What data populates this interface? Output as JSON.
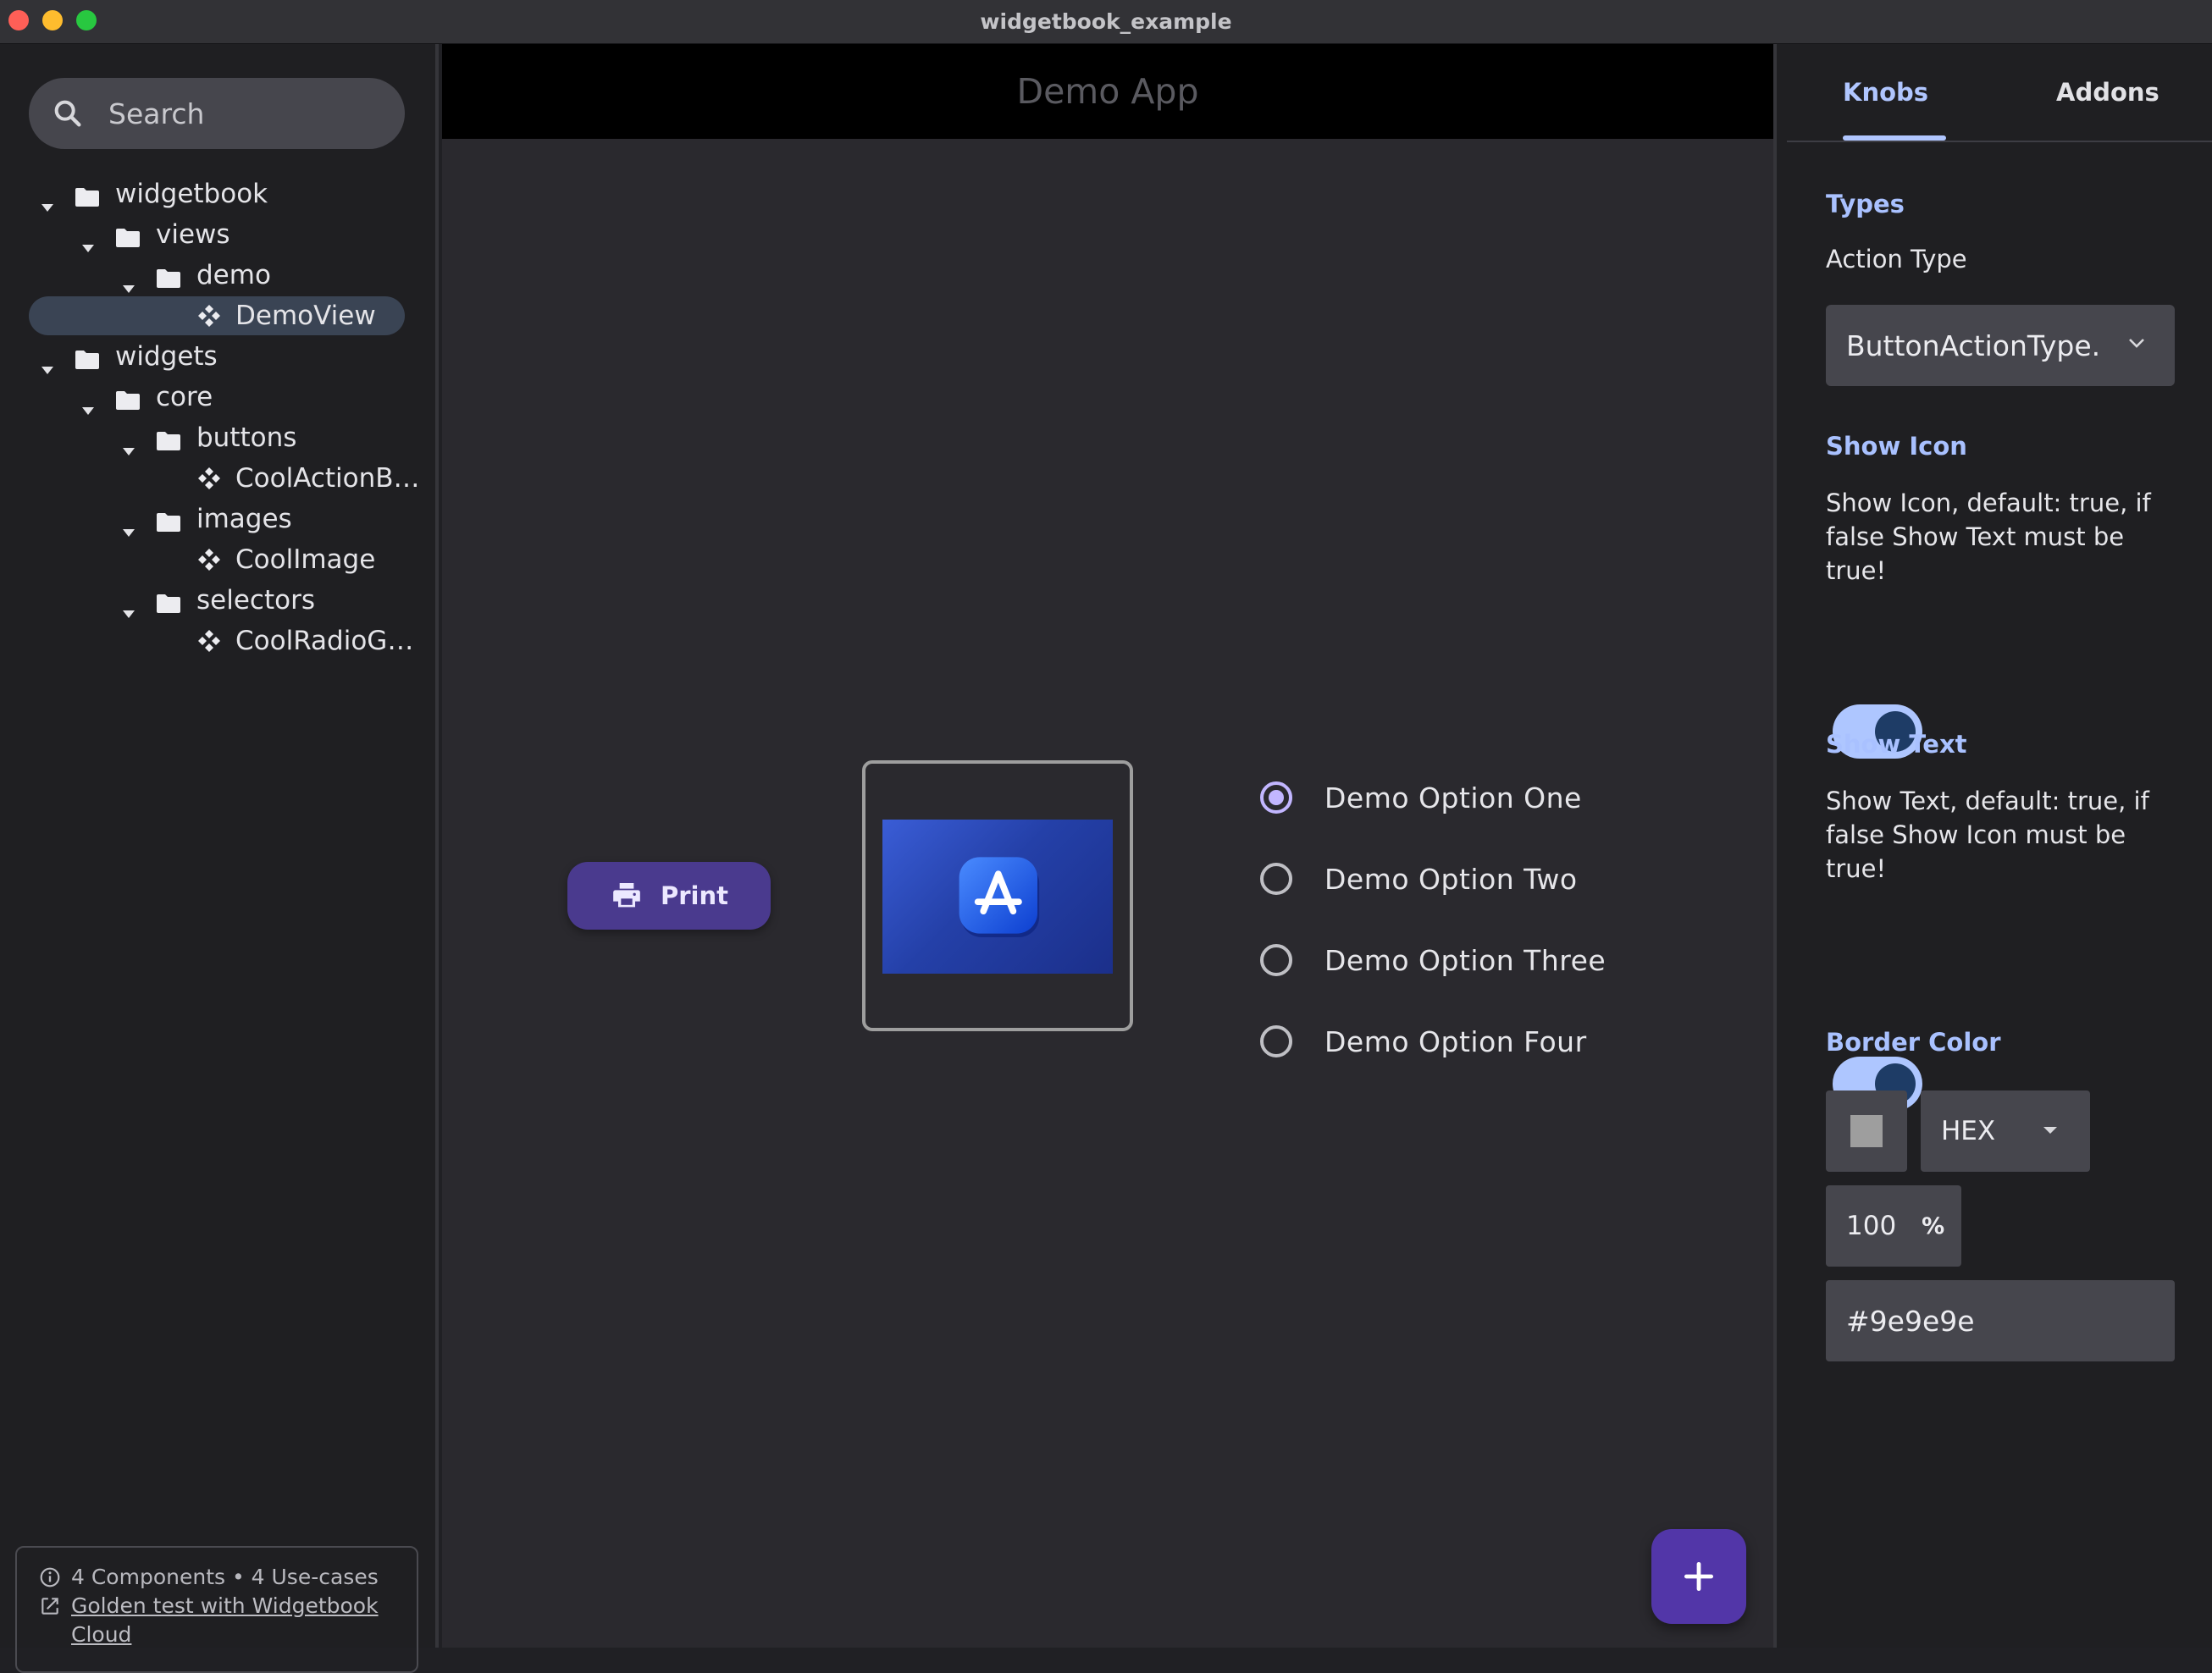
{
  "window": {
    "title": "widgetbook_example"
  },
  "navigation": {
    "search_placeholder": "Search",
    "tree": [
      {
        "label": "widgetbook",
        "kind": "folder",
        "depth": 0,
        "expanded": true
      },
      {
        "label": "views",
        "kind": "folder",
        "depth": 1,
        "expanded": true
      },
      {
        "label": "demo",
        "kind": "folder",
        "depth": 2,
        "expanded": true
      },
      {
        "label": "DemoView",
        "kind": "component",
        "depth": 3,
        "selected": true
      },
      {
        "label": "widgets",
        "kind": "folder",
        "depth": 0,
        "expanded": true
      },
      {
        "label": "core",
        "kind": "folder",
        "depth": 1,
        "expanded": true
      },
      {
        "label": "buttons",
        "kind": "folder",
        "depth": 2,
        "expanded": true
      },
      {
        "label": "CoolActionB…",
        "kind": "component",
        "depth": 3
      },
      {
        "label": "images",
        "kind": "folder",
        "depth": 2,
        "expanded": true
      },
      {
        "label": "CoolImage",
        "kind": "component",
        "depth": 3
      },
      {
        "label": "selectors",
        "kind": "folder",
        "depth": 2,
        "expanded": true
      },
      {
        "label": "CoolRadioG…",
        "kind": "component",
        "depth": 3
      }
    ],
    "footer": {
      "stats": "4 Components • 4 Use-cases",
      "link_line1": "Golden test with Widgetbook",
      "link_line2": "Cloud"
    }
  },
  "preview": {
    "appbar_title": "Demo App",
    "print_button": "Print",
    "image_border_color": "#9e9e9e",
    "radio_options": [
      {
        "label": "Demo Option One",
        "selected": true
      },
      {
        "label": "Demo Option Two",
        "selected": false
      },
      {
        "label": "Demo Option Three",
        "selected": false
      },
      {
        "label": "Demo Option Four",
        "selected": false
      }
    ],
    "fab_icon": "add-icon"
  },
  "knobs_panel": {
    "tabs": [
      {
        "label": "Knobs",
        "active": true
      },
      {
        "label": "Addons",
        "active": false
      }
    ],
    "types": {
      "title": "Types",
      "field_label": "Action Type",
      "value": "ButtonActionType.print"
    },
    "show_icon": {
      "title": "Show Icon",
      "description": "Show Icon, default: true, if false Show Text must be true!",
      "value": true
    },
    "show_text": {
      "title": "Show Text",
      "description": "Show Text, default: true, if false Show Icon must be true!",
      "value": true
    },
    "border_color": {
      "title": "Border Color",
      "format": "HEX",
      "opacity": "100",
      "opacity_unit": "%",
      "hex": "#9e9e9e"
    }
  },
  "colors": {
    "accent": "#b0c6ff",
    "primary_button": "#4a3a8e",
    "fab": "#5236a8",
    "radio_selected": "#c2b6ff"
  }
}
